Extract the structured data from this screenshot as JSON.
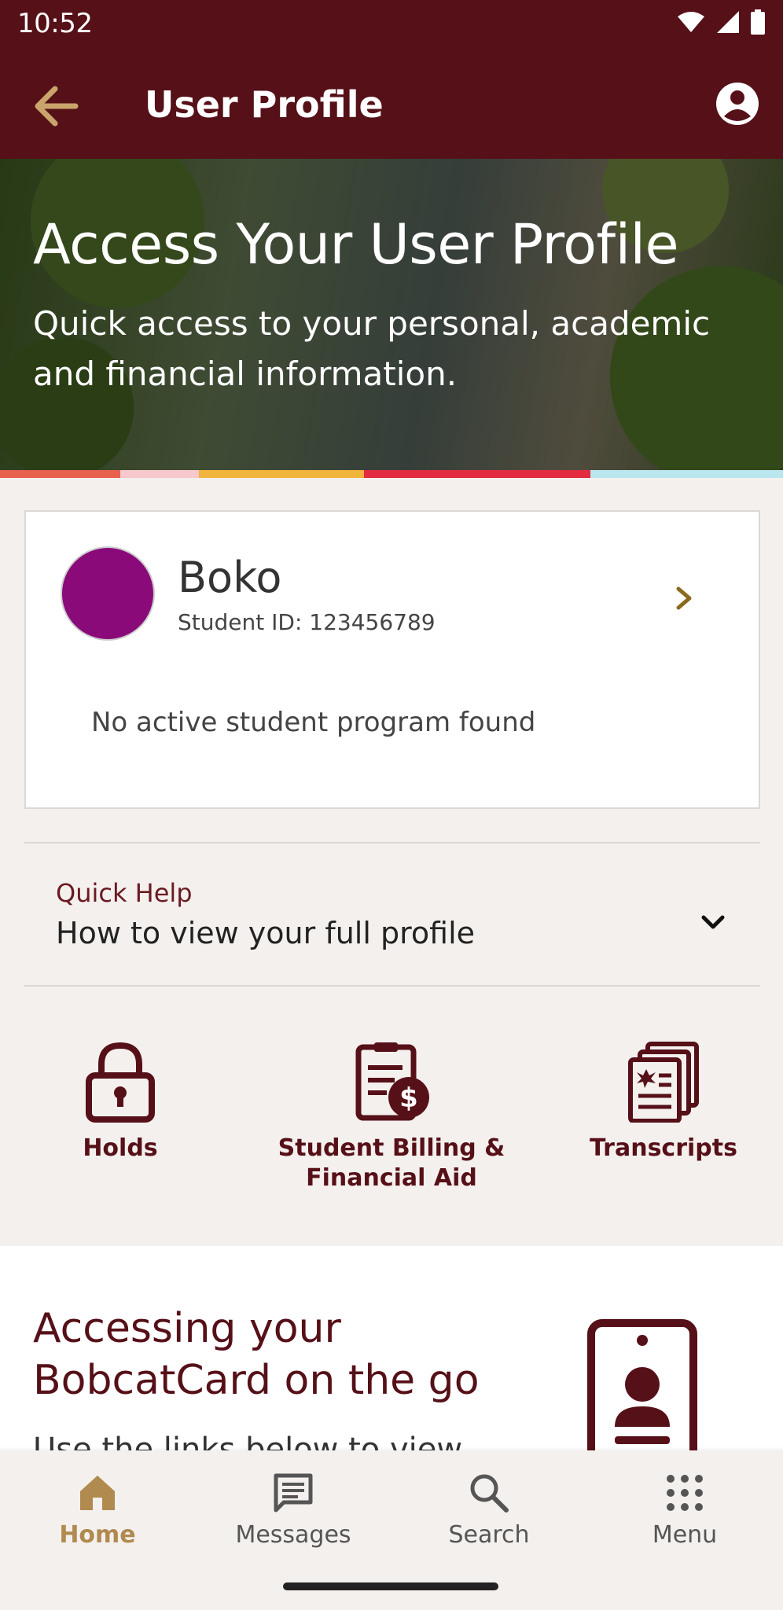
{
  "status_bar": {
    "time": "10:52"
  },
  "app_bar": {
    "title": "User Profile"
  },
  "hero": {
    "title": "Access Your User Profile",
    "subtitle": "Quick access to your personal, academic and financial information."
  },
  "stripe_colors": [
    "#e8614e",
    "#f7c9cc",
    "#f1b43c",
    "#e32c40",
    "#b9e6ef"
  ],
  "profile_card": {
    "name": "Boko",
    "student_id": "Student ID: 123456789",
    "program_status": "No active student program found",
    "avatar_color": "#8a0a7a"
  },
  "quick_help": {
    "label": "Quick Help",
    "question": "How to view your full profile"
  },
  "tiles": [
    {
      "label": "Holds",
      "icon": "lock-icon"
    },
    {
      "label": "Student Billing & Financial Aid",
      "icon": "billing-document-icon"
    },
    {
      "label": "Transcripts",
      "icon": "transcripts-icon"
    }
  ],
  "promo": {
    "title": "Accessing your BobcatCard on the go",
    "body": "Use the links below to view"
  },
  "bottom_nav": [
    {
      "label": "Home",
      "icon": "home-icon",
      "active": true
    },
    {
      "label": "Messages",
      "icon": "messages-icon",
      "active": false
    },
    {
      "label": "Search",
      "icon": "search-icon",
      "active": false
    },
    {
      "label": "Menu",
      "icon": "grid-menu-icon",
      "active": false
    }
  ],
  "colors": {
    "brand_maroon": "#561018",
    "accent_gold": "#b08a4e",
    "background": "#f4f0ee"
  }
}
